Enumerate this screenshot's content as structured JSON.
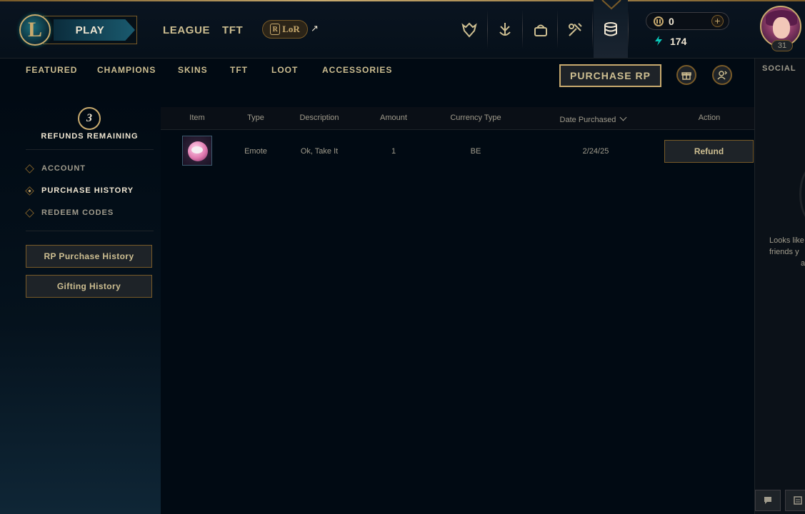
{
  "topbar": {
    "play_label": "PLAY",
    "nav": [
      "LEAGUE",
      "TFT"
    ],
    "lor_label": "LoR",
    "lor_badge": "R",
    "external_arrow": "↗",
    "currency": {
      "rp": "0",
      "be": "174",
      "add": "+"
    },
    "profile_level": "31"
  },
  "store_nav": {
    "tabs": [
      "FEATURED",
      "CHAMPIONS",
      "SKINS",
      "TFT",
      "LOOT",
      "ACCESSORIES"
    ],
    "purchase_rp": "PURCHASE RP"
  },
  "sidebar": {
    "refunds_count": "3",
    "refunds_label": "REFUNDS REMAINING",
    "menu": [
      {
        "label": "ACCOUNT",
        "active": false
      },
      {
        "label": "PURCHASE HISTORY",
        "active": true
      },
      {
        "label": "REDEEM CODES",
        "active": false
      }
    ],
    "buttons": [
      "RP Purchase History",
      "Gifting History"
    ]
  },
  "table": {
    "columns": [
      "Item",
      "Type",
      "Description",
      "Amount",
      "Currency Type",
      "Date Purchased",
      "Action"
    ],
    "rows": [
      {
        "type": "Emote",
        "description": "Ok, Take It",
        "amount": "1",
        "currency": "BE",
        "date": "2/24/25",
        "action": "Refund"
      }
    ]
  },
  "social": {
    "title": "SOCIAL",
    "message": [
      "Looks like",
      "friends y",
      "a"
    ]
  },
  "colors": {
    "gold": "#c8aa6e",
    "gold_dark": "#785a28",
    "text": "#a09b8c",
    "text_bright": "#f0e6d2",
    "bg": "#010a13",
    "teal": "#0ac8b9"
  }
}
